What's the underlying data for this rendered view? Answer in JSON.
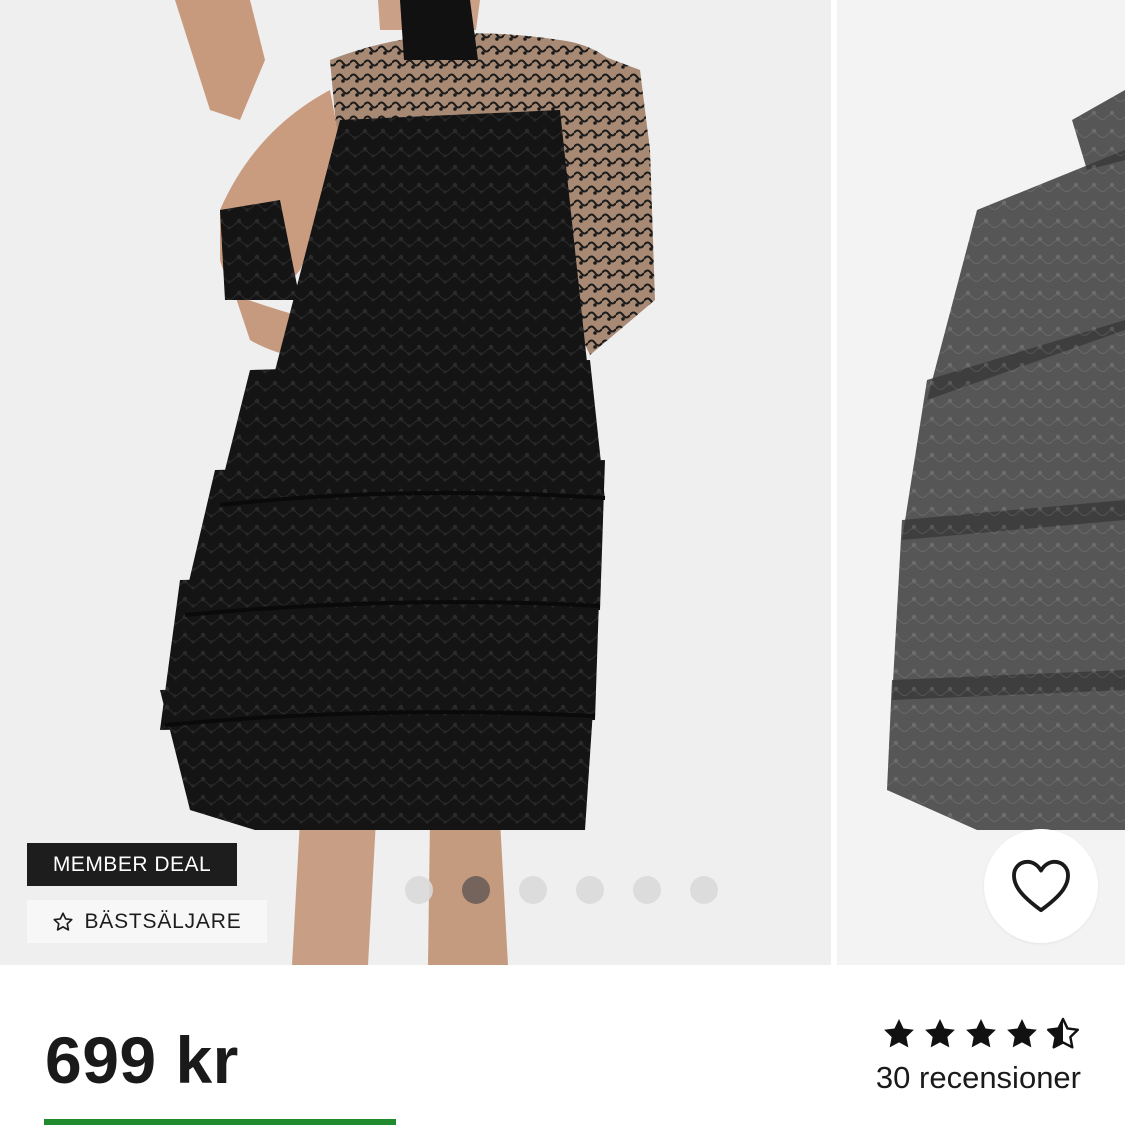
{
  "product": {
    "price": "699 kr",
    "badges": {
      "member_deal": "MEMBER DEAL",
      "bestseller": "BÄSTSÄLJARE"
    },
    "rating": {
      "stars": 4.5,
      "max_stars": 5,
      "reviews_label": "30 recensioner"
    }
  },
  "gallery": {
    "image_count": 6,
    "active_index": 1
  },
  "icons": {
    "badge_icon": "star-outline-icon",
    "favorite_icon": "heart-outline-icon",
    "rating_icon": "star-icon"
  },
  "colors": {
    "badge_dark": "#1d1d1d",
    "dot_active": "#6b5e57",
    "dot_inactive": "#d9d9d9",
    "accent_green": "#1f8a2e"
  }
}
